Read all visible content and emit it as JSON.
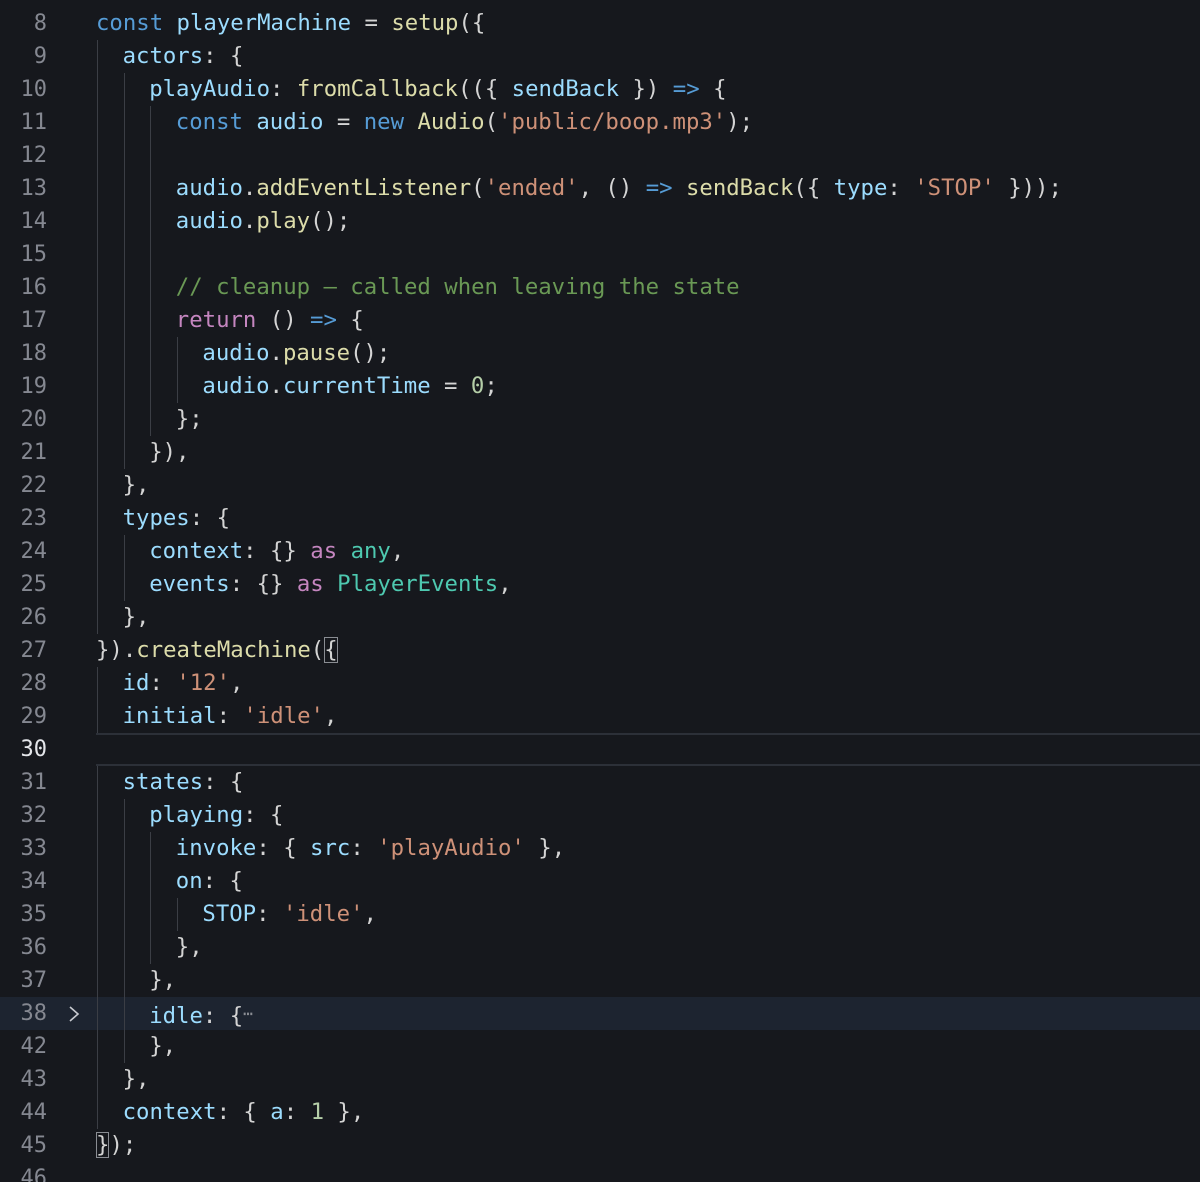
{
  "editor": {
    "colors": {
      "background": "#16181d",
      "keyword": "#569cd6",
      "control": "#c586c0",
      "variable": "#9cdcfe",
      "function": "#dcdcaa",
      "string": "#ce9178",
      "number": "#b5cea8",
      "comment": "#6a9955",
      "type": "#4ec9b0"
    },
    "lines": [
      {
        "num": "8",
        "indent": 0,
        "tokens": [
          [
            "kw",
            "const "
          ],
          [
            "var",
            "playerMachine"
          ],
          [
            "op",
            " = "
          ],
          [
            "fn",
            "setup"
          ],
          [
            "punc",
            "({"
          ]
        ]
      },
      {
        "num": "9",
        "indent": 1,
        "tokens": [
          [
            "var",
            "actors"
          ],
          [
            "punc",
            ": {"
          ]
        ]
      },
      {
        "num": "10",
        "indent": 2,
        "tokens": [
          [
            "var",
            "playAudio"
          ],
          [
            "punc",
            ": "
          ],
          [
            "fn",
            "fromCallback"
          ],
          [
            "punc",
            "(({ "
          ],
          [
            "var",
            "sendBack"
          ],
          [
            "punc",
            " }) "
          ],
          [
            "kw",
            "=>"
          ],
          [
            "punc",
            " {"
          ]
        ]
      },
      {
        "num": "11",
        "indent": 3,
        "tokens": [
          [
            "kw",
            "const "
          ],
          [
            "var",
            "audio"
          ],
          [
            "op",
            " = "
          ],
          [
            "kw",
            "new "
          ],
          [
            "fn",
            "Audio"
          ],
          [
            "punc",
            "("
          ],
          [
            "str",
            "'public/boop.mp3'"
          ],
          [
            "punc",
            ");"
          ]
        ]
      },
      {
        "num": "12",
        "indent": 3,
        "tokens": []
      },
      {
        "num": "13",
        "indent": 3,
        "tokens": [
          [
            "var",
            "audio"
          ],
          [
            "punc",
            "."
          ],
          [
            "fn",
            "addEventListener"
          ],
          [
            "punc",
            "("
          ],
          [
            "str",
            "'ended'"
          ],
          [
            "punc",
            ", () "
          ],
          [
            "kw",
            "=>"
          ],
          [
            "punc",
            " "
          ],
          [
            "fn",
            "sendBack"
          ],
          [
            "punc",
            "({ "
          ],
          [
            "var",
            "type"
          ],
          [
            "punc",
            ": "
          ],
          [
            "str",
            "'STOP'"
          ],
          [
            "punc",
            " }));"
          ]
        ]
      },
      {
        "num": "14",
        "indent": 3,
        "tokens": [
          [
            "var",
            "audio"
          ],
          [
            "punc",
            "."
          ],
          [
            "fn",
            "play"
          ],
          [
            "punc",
            "();"
          ]
        ]
      },
      {
        "num": "15",
        "indent": 3,
        "tokens": []
      },
      {
        "num": "16",
        "indent": 3,
        "tokens": [
          [
            "cmt",
            "// cleanup – called when leaving the state"
          ]
        ]
      },
      {
        "num": "17",
        "indent": 3,
        "tokens": [
          [
            "ctl",
            "return"
          ],
          [
            "punc",
            " () "
          ],
          [
            "kw",
            "=>"
          ],
          [
            "punc",
            " {"
          ]
        ]
      },
      {
        "num": "18",
        "indent": 4,
        "tokens": [
          [
            "var",
            "audio"
          ],
          [
            "punc",
            "."
          ],
          [
            "fn",
            "pause"
          ],
          [
            "punc",
            "();"
          ]
        ]
      },
      {
        "num": "19",
        "indent": 4,
        "tokens": [
          [
            "var",
            "audio"
          ],
          [
            "punc",
            "."
          ],
          [
            "var",
            "currentTime"
          ],
          [
            "op",
            " = "
          ],
          [
            "num",
            "0"
          ],
          [
            "punc",
            ";"
          ]
        ]
      },
      {
        "num": "20",
        "indent": 3,
        "tokens": [
          [
            "punc",
            "};"
          ]
        ]
      },
      {
        "num": "21",
        "indent": 2,
        "tokens": [
          [
            "punc",
            "}),"
          ]
        ]
      },
      {
        "num": "22",
        "indent": 1,
        "tokens": [
          [
            "punc",
            "},"
          ]
        ]
      },
      {
        "num": "23",
        "indent": 1,
        "tokens": [
          [
            "var",
            "types"
          ],
          [
            "punc",
            ": {"
          ]
        ]
      },
      {
        "num": "24",
        "indent": 2,
        "tokens": [
          [
            "var",
            "context"
          ],
          [
            "punc",
            ": {} "
          ],
          [
            "ctl",
            "as "
          ],
          [
            "typ",
            "any"
          ],
          [
            "punc",
            ","
          ]
        ]
      },
      {
        "num": "25",
        "indent": 2,
        "tokens": [
          [
            "var",
            "events"
          ],
          [
            "punc",
            ": {} "
          ],
          [
            "ctl",
            "as "
          ],
          [
            "typ",
            "PlayerEvents"
          ],
          [
            "punc",
            ","
          ]
        ]
      },
      {
        "num": "26",
        "indent": 1,
        "tokens": [
          [
            "punc",
            "},"
          ]
        ]
      },
      {
        "num": "27",
        "indent": 0,
        "tokens": [
          [
            "punc",
            "})."
          ],
          [
            "fn",
            "createMachine"
          ],
          [
            "punc",
            "("
          ],
          [
            "bm",
            "{"
          ]
        ]
      },
      {
        "num": "28",
        "indent": 1,
        "tokens": [
          [
            "var",
            "id"
          ],
          [
            "punc",
            ": "
          ],
          [
            "str",
            "'12'"
          ],
          [
            "punc",
            ","
          ]
        ]
      },
      {
        "num": "29",
        "indent": 1,
        "tokens": [
          [
            "var",
            "initial"
          ],
          [
            "punc",
            ": "
          ],
          [
            "str",
            "'idle'"
          ],
          [
            "punc",
            ","
          ]
        ]
      },
      {
        "num": "30",
        "indent": 0,
        "tokens": [],
        "current": true
      },
      {
        "num": "31",
        "indent": 1,
        "tokens": [
          [
            "var",
            "states"
          ],
          [
            "punc",
            ": {"
          ]
        ]
      },
      {
        "num": "32",
        "indent": 2,
        "tokens": [
          [
            "var",
            "playing"
          ],
          [
            "punc",
            ": {"
          ]
        ]
      },
      {
        "num": "33",
        "indent": 3,
        "tokens": [
          [
            "var",
            "invoke"
          ],
          [
            "punc",
            ": { "
          ],
          [
            "var",
            "src"
          ],
          [
            "punc",
            ": "
          ],
          [
            "str",
            "'playAudio'"
          ],
          [
            "punc",
            " },"
          ]
        ]
      },
      {
        "num": "34",
        "indent": 3,
        "tokens": [
          [
            "var",
            "on"
          ],
          [
            "punc",
            ": {"
          ]
        ]
      },
      {
        "num": "35",
        "indent": 4,
        "tokens": [
          [
            "var",
            "STOP"
          ],
          [
            "punc",
            ": "
          ],
          [
            "str",
            "'idle'"
          ],
          [
            "punc",
            ","
          ]
        ]
      },
      {
        "num": "36",
        "indent": 3,
        "tokens": [
          [
            "punc",
            "},"
          ]
        ]
      },
      {
        "num": "37",
        "indent": 2,
        "tokens": [
          [
            "punc",
            "},"
          ]
        ]
      },
      {
        "num": "38",
        "indent": 2,
        "tokens": [
          [
            "var",
            "idle"
          ],
          [
            "punc",
            ": {"
          ],
          [
            "ellipsis",
            "⋯"
          ]
        ],
        "folded": true
      },
      {
        "num": "42",
        "indent": 2,
        "tokens": [
          [
            "punc",
            "},"
          ]
        ]
      },
      {
        "num": "43",
        "indent": 1,
        "tokens": [
          [
            "punc",
            "},"
          ]
        ]
      },
      {
        "num": "44",
        "indent": 1,
        "tokens": [
          [
            "var",
            "context"
          ],
          [
            "punc",
            ": { "
          ],
          [
            "var",
            "a"
          ],
          [
            "punc",
            ": "
          ],
          [
            "num",
            "1"
          ],
          [
            "punc",
            " },"
          ]
        ]
      },
      {
        "num": "45",
        "indent": 0,
        "tokens": [
          [
            "bm",
            "}"
          ],
          [
            "punc",
            ");"
          ]
        ]
      },
      {
        "num": "46",
        "indent": 0,
        "tokens": []
      }
    ]
  }
}
